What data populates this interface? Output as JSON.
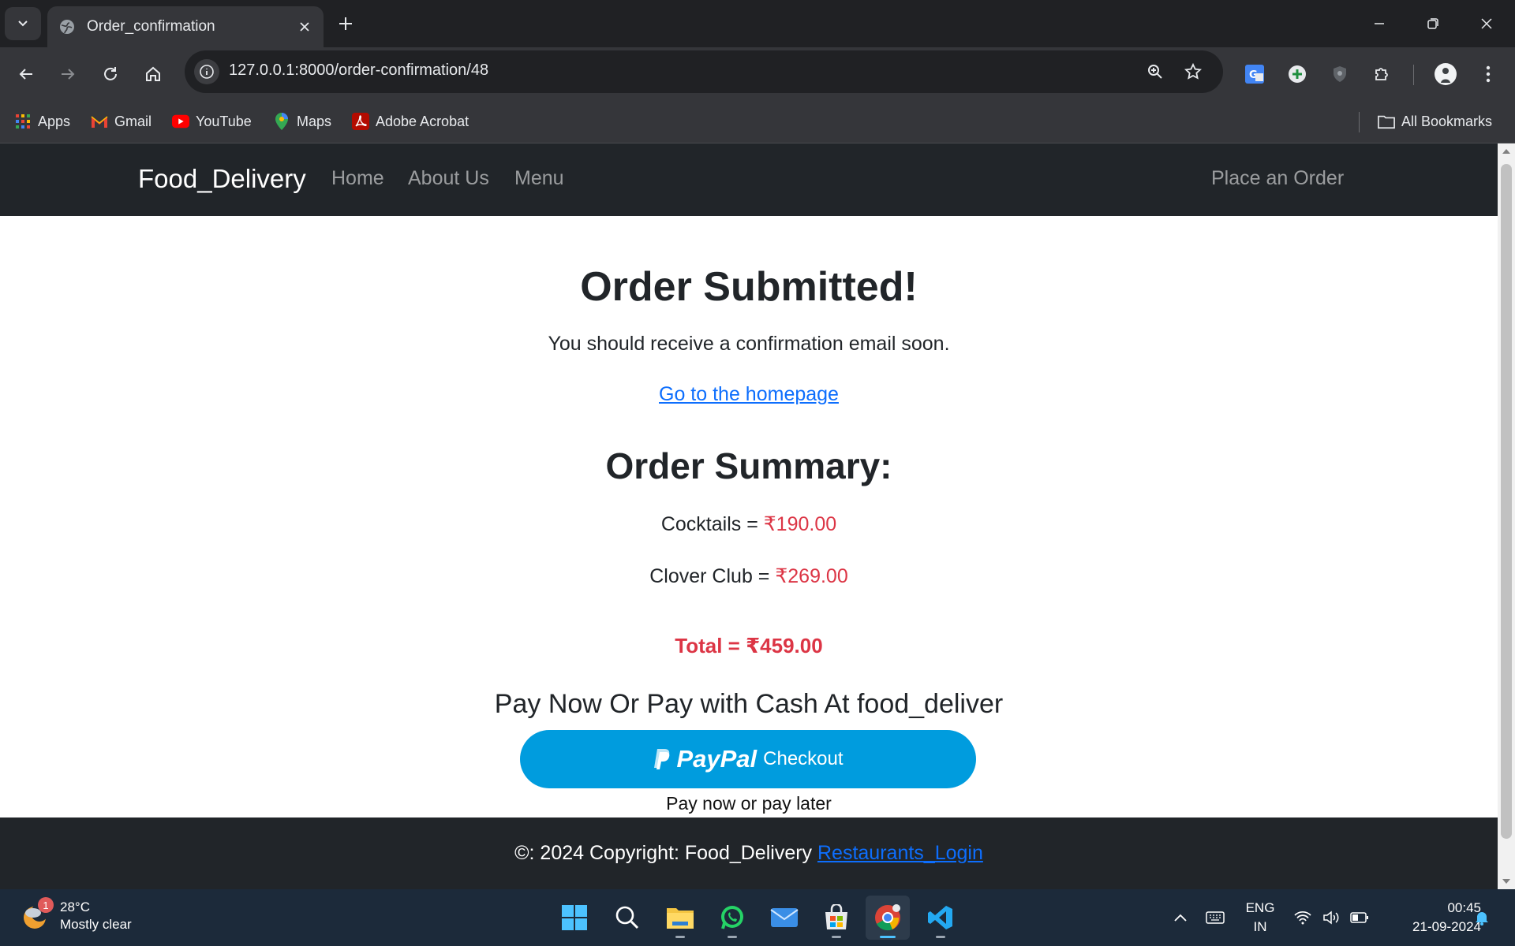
{
  "browser": {
    "tab_title": "Order_confirmation",
    "url": "127.0.0.1:8000/order-confirmation/48",
    "bookmarks": [
      {
        "label": "Apps"
      },
      {
        "label": "Gmail"
      },
      {
        "label": "YouTube"
      },
      {
        "label": "Maps"
      },
      {
        "label": "Adobe Acrobat"
      }
    ],
    "all_bookmarks": "All Bookmarks"
  },
  "site": {
    "brand": "Food_Delivery",
    "nav": [
      "Home",
      "About Us",
      "Menu"
    ],
    "nav_right": "Place an Order"
  },
  "main": {
    "title": "Order Submitted!",
    "lead": "You should receive a confirmation email soon.",
    "home_link": "Go to the homepage",
    "summary_title": "Order Summary:",
    "items": [
      {
        "name": "Cocktails = ",
        "price": "₹190.00"
      },
      {
        "name": "Clover Club = ",
        "price": "₹269.00"
      }
    ],
    "total": "Total = ₹459.00",
    "pay_title": "Pay Now Or Pay with Cash At food_deliver",
    "paypal_word": "PayPal",
    "paypal_checkout": "Checkout",
    "pay_later": "Pay now or pay later"
  },
  "footer": {
    "text": "©: 2024 Copyright: Food_Delivery ",
    "link": "Restaurants_Login"
  },
  "taskbar": {
    "weather_temp": "28°C",
    "weather_desc": "Mostly clear",
    "weather_badge": "1",
    "lang_line1": "ENG",
    "lang_line2": "IN",
    "time": "00:45",
    "date": "21-09-2024"
  },
  "colors": {
    "navbar_bg": "#212529",
    "price_red": "#dc3545",
    "link_blue": "#0d6efd",
    "paypal_blue": "#009cde"
  }
}
